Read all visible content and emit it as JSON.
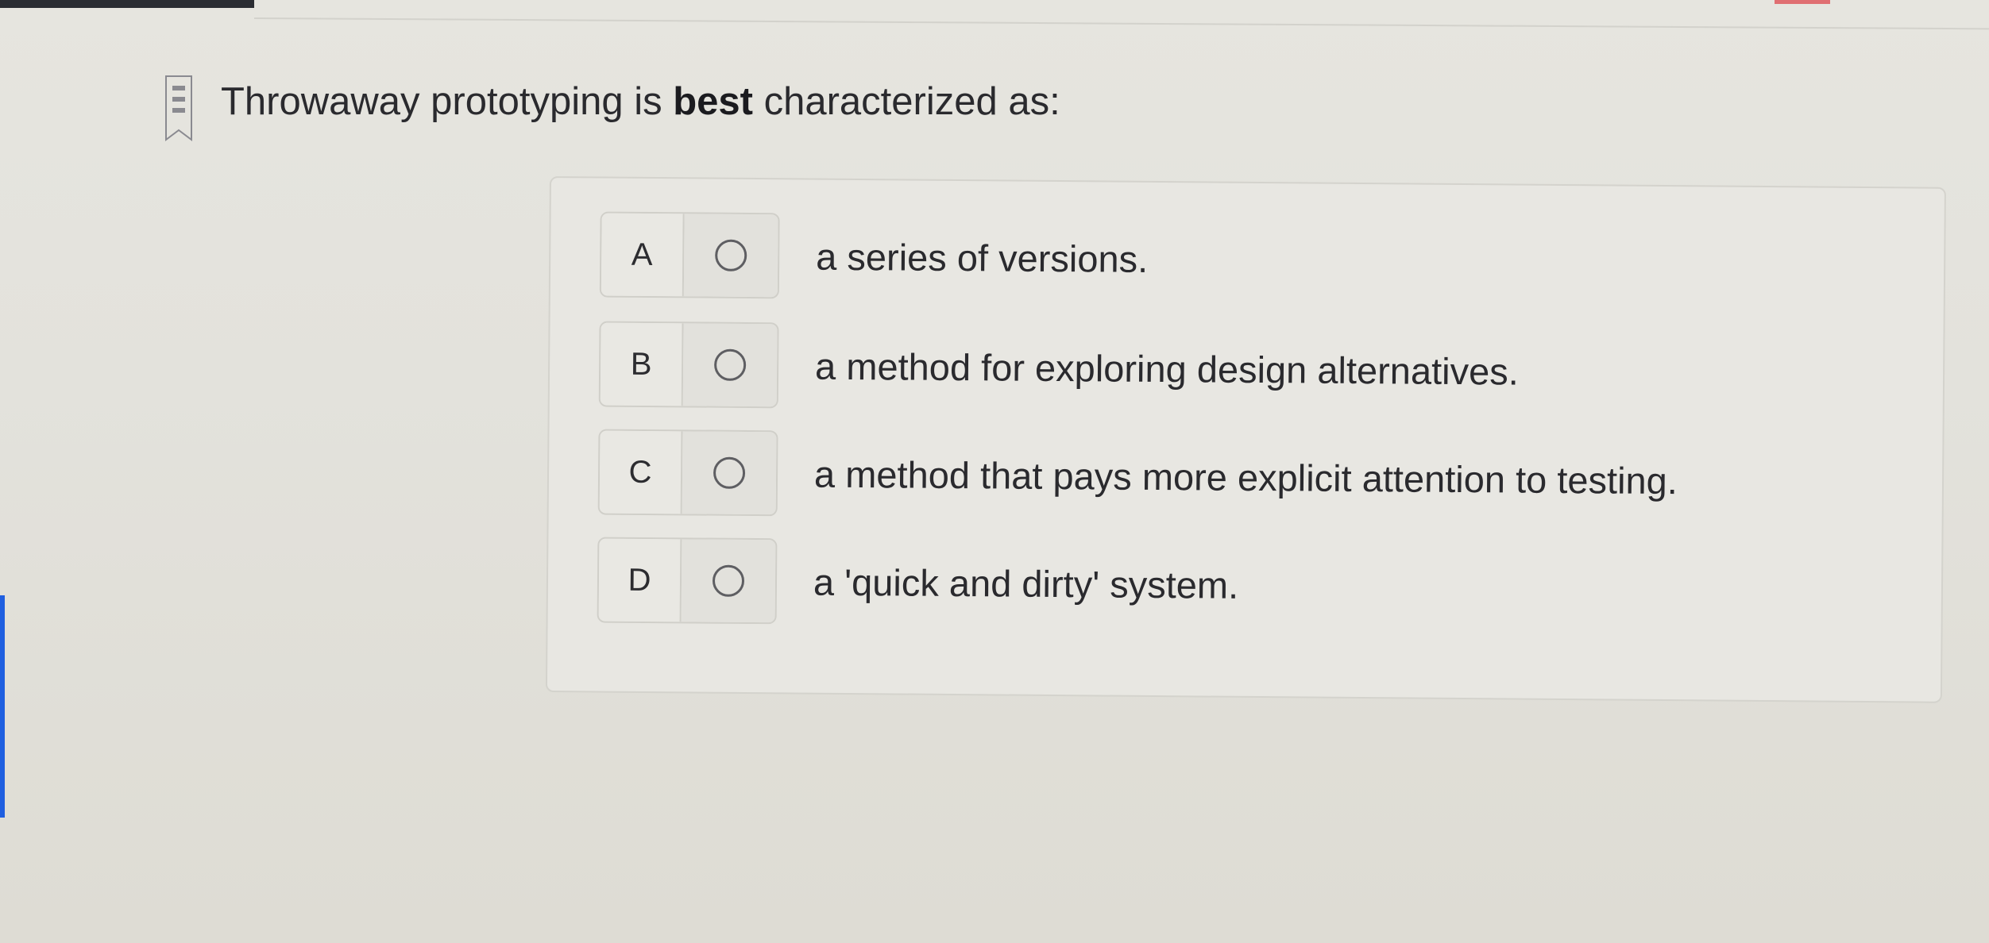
{
  "question": {
    "prefix": "Throwaway prototyping is ",
    "emphasis": "best",
    "suffix": " characterized as:"
  },
  "choices": [
    {
      "letter": "A",
      "text": "a series of versions."
    },
    {
      "letter": "B",
      "text": "a method for exploring design alternatives."
    },
    {
      "letter": "C",
      "text": "a method that pays more explicit attention to testing."
    },
    {
      "letter": "D",
      "text": "a 'quick and dirty' system."
    }
  ],
  "selected_choice": null,
  "icons": {
    "bookmark": "bookmark-flag-icon",
    "radio": "radio-unselected-icon"
  },
  "colors": {
    "background": "#e4e3dd",
    "panel_border": "#d4d3cd",
    "text": "#2a2a2e",
    "left_accent": "#1f5fe0"
  }
}
